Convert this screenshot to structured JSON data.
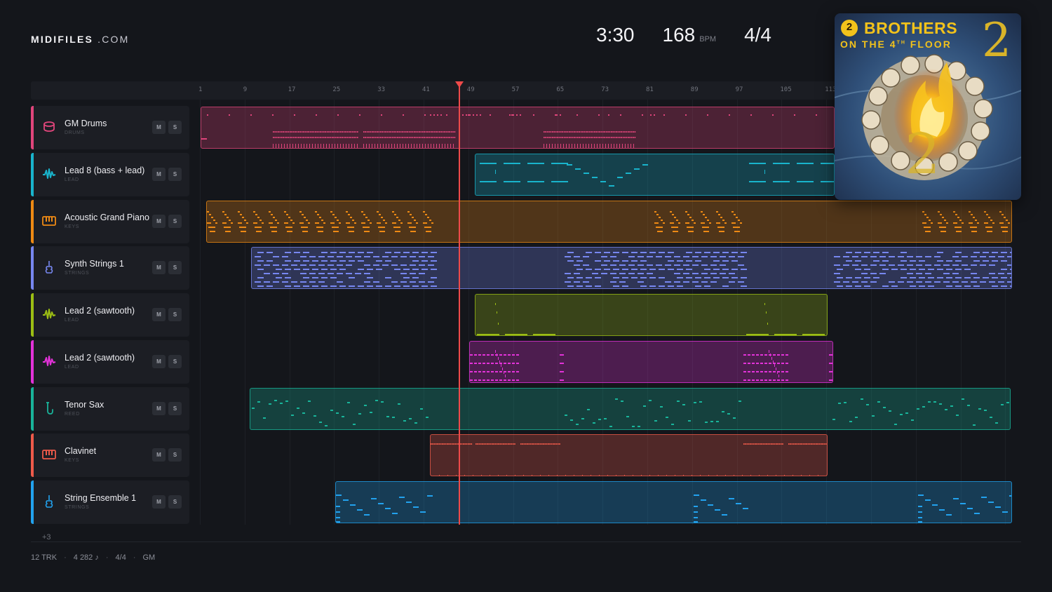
{
  "brand": {
    "name": "MIDIFILES",
    "suffix": ".COM"
  },
  "header": {
    "time": "3:30",
    "tempo": "168",
    "tempo_unit": "BPM",
    "signature": "4/4"
  },
  "ruler": {
    "ticks": [
      "1",
      "9",
      "17",
      "25",
      "33",
      "41",
      "49",
      "57",
      "65",
      "73",
      "81",
      "89",
      "97",
      "105",
      "113"
    ]
  },
  "tracks": [
    {
      "name": "GM Drums",
      "category": "DRUMS",
      "color": "#e0457b",
      "icon": "drum-icon",
      "mute": "M",
      "solo": "S"
    },
    {
      "name": "Lead 8 (bass + lead)",
      "category": "LEAD",
      "color": "#19b4cc",
      "icon": "wave-icon",
      "mute": "M",
      "solo": "S"
    },
    {
      "name": "Acoustic Grand Piano",
      "category": "KEYS",
      "color": "#ee8a14",
      "icon": "keys-icon",
      "mute": "M",
      "solo": "S"
    },
    {
      "name": "Synth Strings 1",
      "category": "STRINGS",
      "color": "#7787f0",
      "icon": "violin-icon",
      "mute": "M",
      "solo": "S"
    },
    {
      "name": "Lead 2 (sawtooth)",
      "category": "LEAD",
      "color": "#9cbe14",
      "icon": "wave-icon",
      "mute": "M",
      "solo": "S"
    },
    {
      "name": "Lead 2 (sawtooth)",
      "category": "LEAD",
      "color": "#e332d9",
      "icon": "wave-icon",
      "mute": "M",
      "solo": "S"
    },
    {
      "name": "Tenor Sax",
      "category": "REED",
      "color": "#19b49a",
      "icon": "sax-icon",
      "mute": "M",
      "solo": "S"
    },
    {
      "name": "Clavinet",
      "category": "KEYS",
      "color": "#ee5a4a",
      "icon": "keys-icon",
      "mute": "M",
      "solo": "S"
    },
    {
      "name": "String Ensemble 1",
      "category": "STRINGS",
      "color": "#22a2ee",
      "icon": "violin-icon",
      "mute": "M",
      "solo": "S"
    }
  ],
  "more_tracks": "+3",
  "footer": {
    "tracks": "12 TRK",
    "notes": "4 282 ♪",
    "signature": "4/4",
    "standard": "GM"
  },
  "album": {
    "badge": "2",
    "title": "BROTHERS",
    "subtitle_pre": "ON THE 4",
    "subtitle_sup": "TH",
    "subtitle_post": " FLOOR",
    "big_number": "2"
  }
}
